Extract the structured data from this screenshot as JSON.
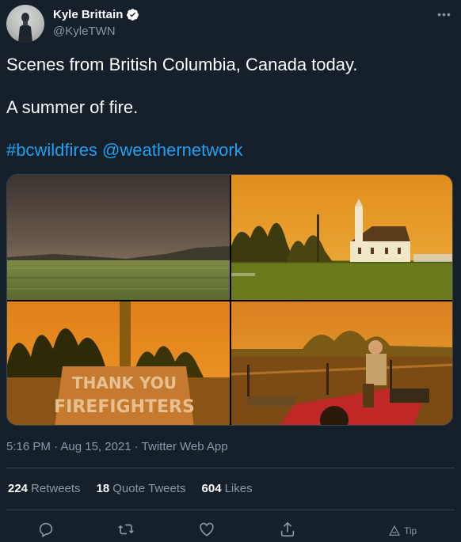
{
  "author": {
    "display_name": "Kyle Brittain",
    "handle": "@KyleTWN",
    "verified_icon": "verified-badge-icon"
  },
  "tweet": {
    "line1": "Scenes from British Columbia, Canada today.",
    "line2": "A summer of fire.",
    "hashtags": "#bcwildfires @weathernetwork"
  },
  "media": {
    "photo4_sign_text_line1": "THANK YOU",
    "photo4_sign_text_line2": "FIREFIGHTERS"
  },
  "meta": {
    "timestamp": "5:16 PM · Aug 15, 2021 · Twitter Web App"
  },
  "stats": [
    {
      "count": "224",
      "label": "Retweets"
    },
    {
      "count": "18",
      "label": "Quote Tweets"
    },
    {
      "count": "604",
      "label": "Likes"
    }
  ],
  "actions": {
    "tip_label": "Tip"
  },
  "colors": {
    "background": "#15202b",
    "link": "#1da1f2",
    "secondary_text": "#8899a6",
    "divider": "#38444d"
  }
}
